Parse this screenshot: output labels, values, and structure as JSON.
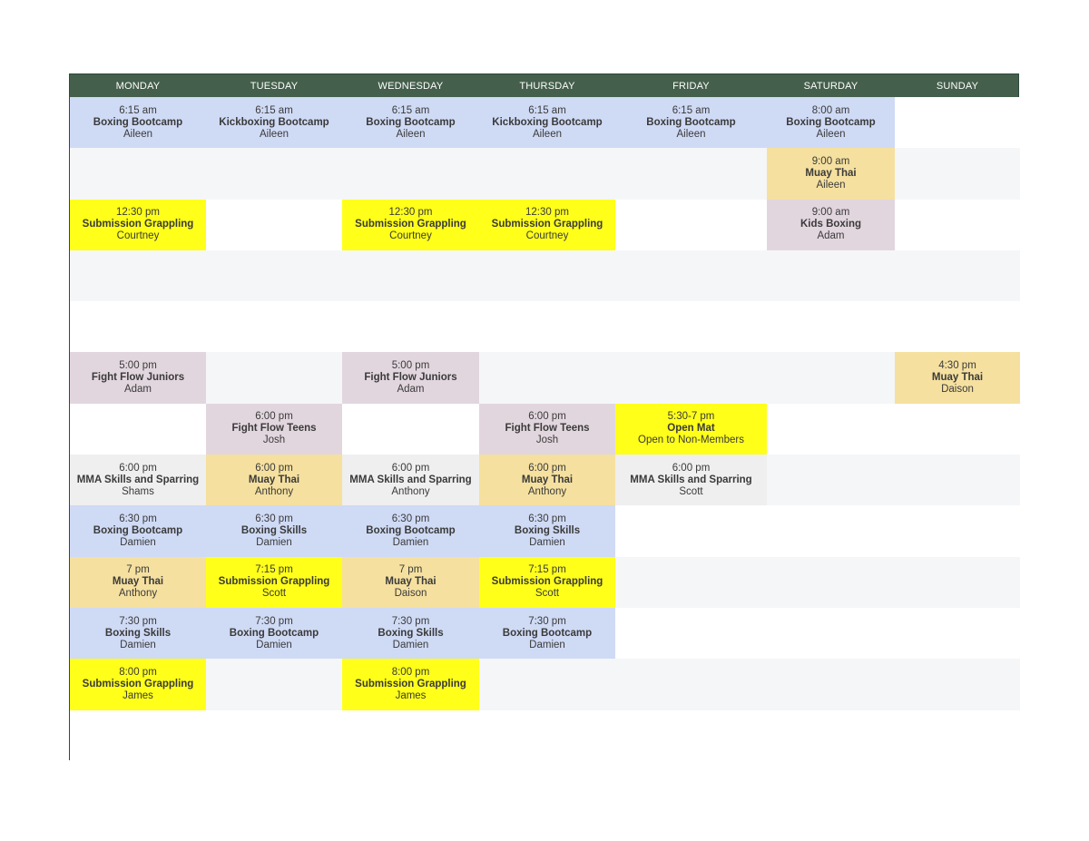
{
  "days": [
    "MONDAY",
    "TUESDAY",
    "WEDNESDAY",
    "THURSDAY",
    "FRIDAY",
    "SATURDAY",
    "SUNDAY"
  ],
  "colors": {
    "header": "#445f4b",
    "blue": "#cfdaf5",
    "yellow": "#ffff1a",
    "mauve": "#e2d6de",
    "tan": "#f5e09f",
    "gray": "#efefef",
    "stripe": "#f5f6f8"
  },
  "rows": [
    [
      {
        "time": "6:15 am",
        "title": "Boxing Bootcamp",
        "instructor": "Aileen",
        "color": "blue"
      },
      {
        "time": "6:15 am",
        "title": "Kickboxing Bootcamp",
        "instructor": "Aileen",
        "color": "blue"
      },
      {
        "time": "6:15 am",
        "title": "Boxing Bootcamp",
        "instructor": "Aileen",
        "color": "blue"
      },
      {
        "time": "6:15 am",
        "title": "Kickboxing Bootcamp",
        "instructor": "Aileen",
        "color": "blue"
      },
      {
        "time": "6:15 am",
        "title": "Boxing Bootcamp",
        "instructor": "Aileen",
        "color": "blue"
      },
      {
        "time": "8:00 am",
        "title": "Boxing Bootcamp",
        "instructor": "Aileen",
        "color": "blue"
      },
      null
    ],
    [
      null,
      null,
      null,
      null,
      null,
      {
        "time": "9:00 am",
        "title": "Muay Thai",
        "instructor": "Aileen",
        "color": "tan"
      },
      null
    ],
    [
      {
        "time": "12:30 pm",
        "title": "Submission Grappling",
        "instructor": "Courtney",
        "color": "yellow"
      },
      null,
      {
        "time": "12:30 pm",
        "title": "Submission Grappling",
        "instructor": "Courtney",
        "color": "yellow"
      },
      {
        "time": "12:30 pm",
        "title": "Submission Grappling",
        "instructor": "Courtney",
        "color": "yellow"
      },
      null,
      {
        "time": "9:00 am",
        "title": "Kids Boxing",
        "instructor": "Adam",
        "color": "mauve"
      },
      null
    ],
    [
      null,
      null,
      null,
      null,
      null,
      null,
      null
    ],
    [
      null,
      null,
      null,
      null,
      null,
      null,
      null
    ],
    [
      {
        "time": "5:00 pm",
        "title": "Fight Flow Juniors",
        "instructor": "Adam",
        "color": "mauve"
      },
      null,
      {
        "time": "5:00 pm",
        "title": "Fight Flow Juniors",
        "instructor": "Adam",
        "color": "mauve"
      },
      null,
      null,
      null,
      {
        "time": "4:30 pm",
        "title": "Muay Thai",
        "instructor": "Daison",
        "color": "tan"
      }
    ],
    [
      null,
      {
        "time": "6:00 pm",
        "title": "Fight Flow Teens",
        "instructor": "Josh",
        "color": "mauve"
      },
      null,
      {
        "time": "6:00 pm",
        "title": "Fight Flow Teens",
        "instructor": "Josh",
        "color": "mauve"
      },
      {
        "time": "5:30-7 pm",
        "title": "Open Mat",
        "instructor": "Open to Non-Members",
        "color": "yellow"
      },
      null,
      null
    ],
    [
      {
        "time": "6:00 pm",
        "title": "MMA Skills and Sparring",
        "instructor": "Shams",
        "color": "gray"
      },
      {
        "time": "6:00 pm",
        "title": "Muay Thai",
        "instructor": "Anthony",
        "color": "tan"
      },
      {
        "time": "6:00 pm",
        "title": "MMA Skills and Sparring",
        "instructor": "Anthony",
        "color": "gray"
      },
      {
        "time": "6:00 pm",
        "title": "Muay Thai",
        "instructor": "Anthony",
        "color": "tan"
      },
      {
        "time": "6:00 pm",
        "title": "MMA Skills and Sparring",
        "instructor": "Scott",
        "color": "gray"
      },
      null,
      null
    ],
    [
      {
        "time": "6:30 pm",
        "title": "Boxing Bootcamp",
        "instructor": "Damien",
        "color": "blue"
      },
      {
        "time": "6:30 pm",
        "title": "Boxing Skills",
        "instructor": "Damien",
        "color": "blue"
      },
      {
        "time": "6:30 pm",
        "title": "Boxing Bootcamp",
        "instructor": "Damien",
        "color": "blue"
      },
      {
        "time": "6:30 pm",
        "title": "Boxing Skills",
        "instructor": "Damien",
        "color": "blue"
      },
      null,
      null,
      null
    ],
    [
      {
        "time": "7 pm",
        "title": "Muay Thai",
        "instructor": "Anthony",
        "color": "tan"
      },
      {
        "time": "7:15 pm",
        "title": "Submission Grappling",
        "instructor": "Scott",
        "color": "yellow"
      },
      {
        "time": "7 pm",
        "title": "Muay Thai",
        "instructor": "Daison",
        "color": "tan"
      },
      {
        "time": "7:15 pm",
        "title": "Submission Grappling",
        "instructor": "Scott",
        "color": "yellow"
      },
      null,
      null,
      null
    ],
    [
      {
        "time": "7:30 pm",
        "title": "Boxing Skills",
        "instructor": "Damien",
        "color": "blue"
      },
      {
        "time": "7:30 pm",
        "title": "Boxing Bootcamp",
        "instructor": "Damien",
        "color": "blue"
      },
      {
        "time": "7:30 pm",
        "title": "Boxing Skills",
        "instructor": "Damien",
        "color": "blue"
      },
      {
        "time": "7:30 pm",
        "title": "Boxing Bootcamp",
        "instructor": "Damien",
        "color": "blue"
      },
      null,
      null,
      null
    ],
    [
      {
        "time": "8:00 pm",
        "title": "Submission Grappling",
        "instructor": "James",
        "color": "yellow"
      },
      null,
      {
        "time": "8:00 pm",
        "title": "Submission Grappling",
        "instructor": "James",
        "color": "yellow"
      },
      null,
      null,
      null,
      null
    ],
    [
      null,
      null,
      null,
      null,
      null,
      null,
      null
    ]
  ]
}
